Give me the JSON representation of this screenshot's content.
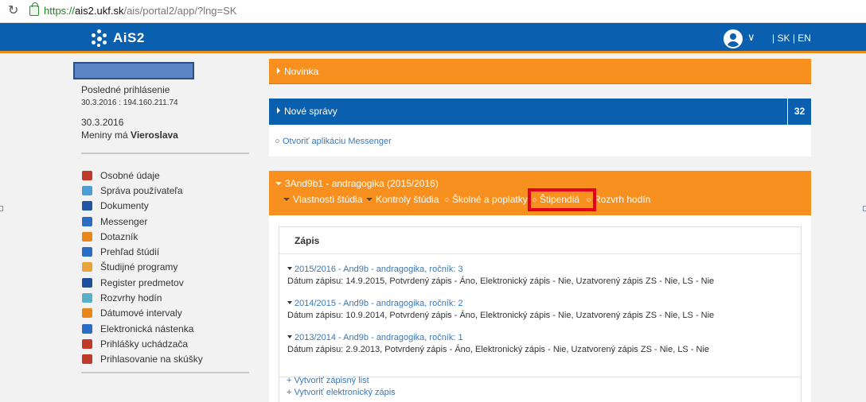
{
  "browser": {
    "url_scheme": "https://",
    "url_host": "ais2.ukf.sk",
    "url_path": "/ais/portal2/app/?lng=SK"
  },
  "header": {
    "logo": "AiS2",
    "lang_sk": "SK",
    "lang_en": "EN",
    "lang_sep1": "|",
    "lang_sep2": "|"
  },
  "sidebar": {
    "last_login_label": "Posledné prihlásenie",
    "last_login_value": "30.3.2016 : 194.160.211.74",
    "today": "30.3.2016",
    "nameday_prefix": "Meniny má ",
    "nameday_name": "Vieroslava",
    "items": [
      {
        "label": "Osobné údaje",
        "color": "#c0392b"
      },
      {
        "label": "Správa používateľa",
        "color": "#4a9fd6"
      },
      {
        "label": "Dokumenty",
        "color": "#2255a4"
      },
      {
        "label": "Messenger",
        "color": "#2b6cc4"
      },
      {
        "label": "Dotazník",
        "color": "#e8861a"
      },
      {
        "label": "Prehľad štúdií",
        "color": "#2b6cc4"
      },
      {
        "label": "Študijné programy",
        "color": "#e8a33a"
      },
      {
        "label": "Register predmetov",
        "color": "#1d4f9c"
      },
      {
        "label": "Rozvrhy hodín",
        "color": "#5bb0c9"
      },
      {
        "label": "Dátumové intervaly",
        "color": "#e8861a"
      },
      {
        "label": "Elektronická nástenka",
        "color": "#2b6cc4"
      },
      {
        "label": "Prihlášky uchádzača",
        "color": "#c0392b"
      },
      {
        "label": "Prihlasovanie na skúšky",
        "color": "#c0392b"
      }
    ]
  },
  "panels": {
    "novinka": "Novinka",
    "spravy": "Nové správy",
    "spravy_count": "32",
    "messenger_link": "Otvoriť aplikáciu Messenger"
  },
  "study": {
    "title": "3And9b1 - andragogika (2015/2016)",
    "nav": {
      "vlastnosti": "Vlastnosti štúdia",
      "kontroly": "Kontroly štúdia",
      "skolne": "Školné a poplatky",
      "stipendia": "Štipendiá",
      "rozvrh": "Rozvrh hodín"
    }
  },
  "zapis": {
    "title": "Zápis",
    "entries": [
      {
        "head": "2015/2016 - And9b - andragogika, ročník: 3",
        "detail": "Dátum zápisu: 14.9.2015, Potvrdený zápis - Áno, Elektronický zápis - Nie, Uzatvorený zápis ZS - Nie, LS - Nie"
      },
      {
        "head": "2014/2015 - And9b - andragogika, ročník: 2",
        "detail": "Dátum zápisu: 10.9.2014, Potvrdený zápis - Áno, Elektronický zápis - Nie, Uzatvorený zápis ZS - Nie, LS - Nie"
      },
      {
        "head": "2013/2014 - And9b - andragogika, ročník: 1",
        "detail": "Dátum zápisu: 2.9.2013, Potvrdený zápis - Áno, Elektronický zápis - Nie, Uzatvorený zápis ZS - Nie, LS - Nie"
      }
    ],
    "action_list": "+ Vytvoriť zápisný list",
    "action_electronic": "+ Vytvoriť elektronický zápis"
  }
}
